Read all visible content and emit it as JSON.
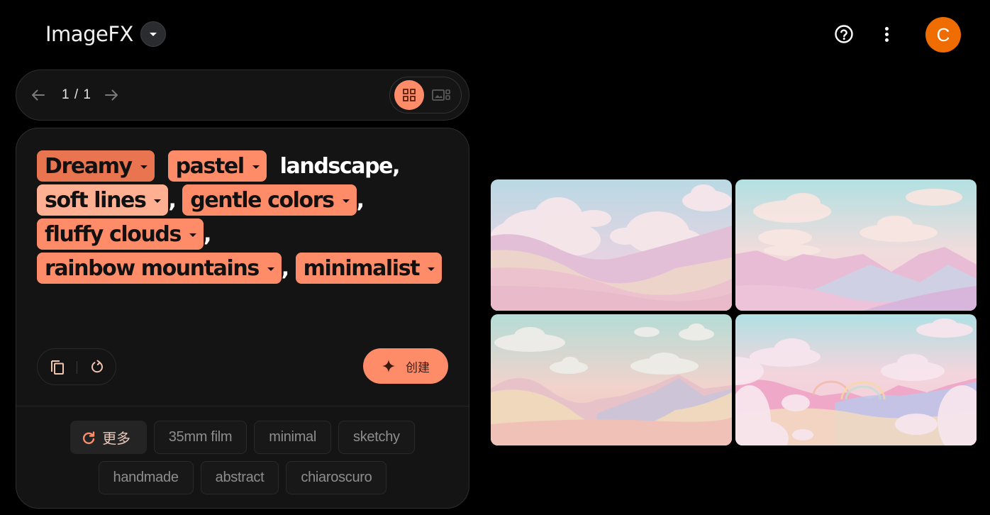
{
  "header": {
    "app_title": "ImageFX",
    "avatar_initial": "C",
    "icons": {
      "app_menu": "chevron-down-icon",
      "help": "help-circle-icon",
      "more": "more-vertical-icon"
    }
  },
  "pager": {
    "page_indicator": "1 / 1",
    "icons": {
      "prev": "arrow-left-icon",
      "next": "arrow-right-icon",
      "grid_view": "grid-view-icon",
      "single_view": "single-view-icon"
    },
    "active_view": "grid"
  },
  "prompt": {
    "lines": [
      [
        {
          "type": "chip",
          "text": "Dreamy",
          "style": "dreamy"
        },
        {
          "type": "sep",
          "text": "  "
        },
        {
          "type": "chip",
          "text": "pastel",
          "style": "default"
        },
        {
          "type": "sep",
          "text": "  "
        },
        {
          "type": "plain",
          "text": "landscape,"
        }
      ],
      [
        {
          "type": "chip",
          "text": "soft lines",
          "style": "soft"
        },
        {
          "type": "sep",
          "text": ", "
        },
        {
          "type": "chip",
          "text": "gentle colors",
          "style": "default"
        },
        {
          "type": "sep",
          "text": ","
        }
      ],
      [
        {
          "type": "chip",
          "text": "fluffy clouds",
          "style": "default"
        },
        {
          "type": "sep",
          "text": ","
        }
      ],
      [
        {
          "type": "chip",
          "text": "rainbow mountains",
          "style": "default"
        },
        {
          "type": "sep",
          "text": ", "
        },
        {
          "type": "chip",
          "text": "minimalist",
          "style": "default"
        }
      ]
    ],
    "create_label": "创建",
    "icons": {
      "copy": "copy-icon",
      "reset": "reset-icon",
      "create": "sparkle-icon"
    }
  },
  "suggestions": {
    "more_label": "更多",
    "more_icon": "refresh-icon",
    "rows": [
      [
        "35mm film",
        "minimal",
        "sketchy"
      ],
      [
        "handmade",
        "abstract",
        "chiaroscuro"
      ]
    ]
  },
  "gallery": {
    "images": [
      {
        "name": "generated-image-1",
        "description": "pastel pink rolling hills with fluffy clouds"
      },
      {
        "name": "generated-image-2",
        "description": "pastel pink and blue mountain range with clouds"
      },
      {
        "name": "generated-image-3",
        "description": "minimal peach dunes with line-art clouds"
      },
      {
        "name": "generated-image-4",
        "description": "rainbow mountains surrounded by pink clouds"
      }
    ]
  },
  "colors": {
    "accent": "#ff8c69",
    "accent_dark": "#e8754f",
    "accent_light": "#ffb093",
    "avatar": "#ef6c00",
    "panel_bg": "#141414",
    "page_bg": "#000000"
  }
}
